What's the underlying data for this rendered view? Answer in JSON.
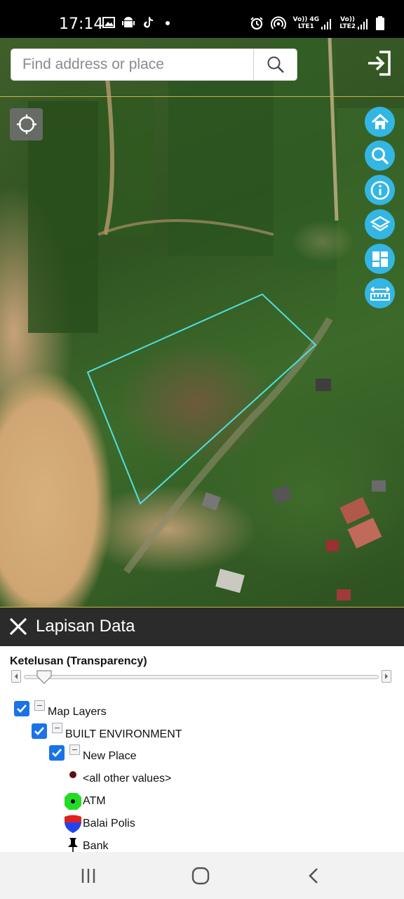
{
  "status_bar": {
    "time": "17:14",
    "left_icons": [
      "image-icon",
      "android-icon",
      "tiktok-icon",
      "dot-icon"
    ],
    "right_icons": [
      "alarm-icon",
      "hotspot-icon"
    ],
    "sim1": {
      "top": "Vo))  4G",
      "bottom": "LTE1"
    },
    "sim2": {
      "top": "Vo))",
      "bottom": "LTE2"
    }
  },
  "map": {
    "search": {
      "placeholder": "Find address or place"
    },
    "search_button_icon": "search-icon",
    "logout_icon": "sign-in-icon",
    "locate_icon": "crosshair-icon",
    "tools": [
      "home-icon",
      "search-icon",
      "info-icon",
      "layers-icon",
      "dashboard-icon",
      "measure-icon"
    ],
    "boundary_color": "#4de0e0"
  },
  "panel": {
    "title": "Lapisan Data",
    "transparency_label": "Ketelusan (Transparency)",
    "transparency_value": 0.06,
    "tree": {
      "root": {
        "label": "Map Layers",
        "checked": true
      },
      "group": {
        "label": "BUILT ENVIRONMENT",
        "checked": true
      },
      "layer": {
        "label": "New Place",
        "checked": true
      }
    },
    "legend": [
      {
        "label": "<all other values>",
        "icon": "dot-icon",
        "color": "#5a1010"
      },
      {
        "label": "ATM",
        "icon": "atm-icon",
        "color": "#22dd22"
      },
      {
        "label": "Balai Polis",
        "icon": "police-shield-icon",
        "color": "#2244ee"
      },
      {
        "label": "Bank",
        "icon": "pushpin-icon",
        "color": "#000000"
      }
    ]
  },
  "navbar": {
    "buttons": [
      "recent-apps-icon",
      "home-icon",
      "back-icon"
    ]
  }
}
